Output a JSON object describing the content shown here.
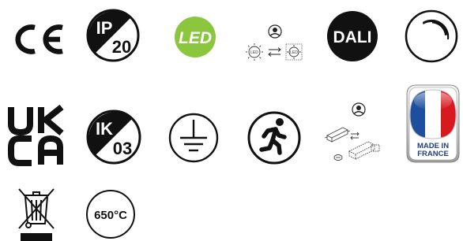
{
  "icons": {
    "ce": {
      "name": "ce-marking",
      "text": "CE"
    },
    "ip20": {
      "name": "ip-rating",
      "top": "IP",
      "bottom": "20"
    },
    "led": {
      "name": "led-light-source",
      "text": "LED",
      "color": "#8cc63f"
    },
    "led_replaceable": {
      "name": "led-replaceable",
      "left_label": "LED",
      "right_label": "LED"
    },
    "dali": {
      "name": "dali-dimming",
      "text": "DALI"
    },
    "dimmable": {
      "name": "dimmable"
    },
    "ukca": {
      "name": "ukca-marking",
      "line1": "UK",
      "line2": "CA"
    },
    "ik03": {
      "name": "impact-rating",
      "top": "IK",
      "bottom": "03"
    },
    "earth": {
      "name": "protective-earth"
    },
    "emergency": {
      "name": "emergency-exit"
    },
    "driver_replaceable": {
      "name": "driver-replaceable"
    },
    "made_in_france": {
      "name": "made-in-france",
      "line1": "MADE IN",
      "line2": "FRANCE",
      "colors": {
        "blue": "#1d4f9e",
        "white": "#ffffff",
        "red": "#d71920"
      }
    },
    "weee": {
      "name": "weee-crossed-bin"
    },
    "glow_wire": {
      "name": "glow-wire-test",
      "text": "650°C"
    }
  }
}
